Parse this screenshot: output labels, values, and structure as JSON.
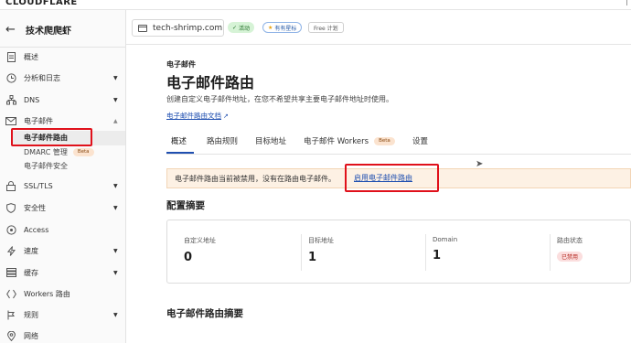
{
  "brand": "CLOUDFLARE",
  "sidebar": {
    "back_icon": "arrow-left-icon",
    "account_name": "技术爬爬虾",
    "items": [
      {
        "label": "概述",
        "icon": "doc-icon"
      },
      {
        "label": "分析和日志",
        "icon": "clock-icon"
      },
      {
        "label": "DNS",
        "icon": "sitemap-icon"
      },
      {
        "label": "电子邮件",
        "icon": "mail-icon"
      },
      {
        "label": "SSL/TLS",
        "icon": "lock-icon"
      },
      {
        "label": "安全性",
        "icon": "shield-icon"
      },
      {
        "label": "Access",
        "icon": "access-icon"
      },
      {
        "label": "速度",
        "icon": "bolt-icon"
      },
      {
        "label": "缓存",
        "icon": "cache-icon"
      },
      {
        "label": "Workers 路由",
        "icon": "workers-icon"
      },
      {
        "label": "规则",
        "icon": "rules-icon"
      },
      {
        "label": "网络",
        "icon": "location-icon"
      }
    ],
    "email_sub": [
      {
        "label": "电子邮件路由"
      },
      {
        "label": "DMARC 管理",
        "badge": "Beta"
      },
      {
        "label": "电子邮件安全"
      }
    ]
  },
  "header": {
    "domain": "tech-shrimp.com",
    "status": "活动",
    "plan": "有有星标",
    "free": "Free 计划"
  },
  "main": {
    "eyebrow": "电子邮件",
    "title": "电子邮件路由",
    "description": "创建自定义电子邮件地址，在您不希望共享主要电子邮件地址时使用。",
    "doc_link": "电子邮件路由文档",
    "tabs": [
      {
        "label": "概述"
      },
      {
        "label": "路由规则"
      },
      {
        "label": "目标地址"
      },
      {
        "label": "电子邮件 Workers",
        "badge": "Beta"
      },
      {
        "label": "设置"
      }
    ],
    "banner": {
      "message": "电子邮件路由当前被禁用，没有在路由电子邮件。",
      "action": "启用电子邮件路由"
    },
    "config_title": "配置摘要",
    "stats": [
      {
        "label": "自定义地址",
        "value": "0"
      },
      {
        "label": "目标地址",
        "value": "1"
      },
      {
        "label": "Domain",
        "value": "1"
      },
      {
        "label": "路由状态",
        "badge": "已禁用"
      }
    ],
    "summary_title": "电子邮件路由摘要"
  },
  "colors": {
    "accent": "#1f4fb0",
    "highlight_box": "#e0111b",
    "banner_bg": "#fdf1e4",
    "status_active_bg": "#d6f3d6",
    "disabled_bg": "#fbdede"
  }
}
